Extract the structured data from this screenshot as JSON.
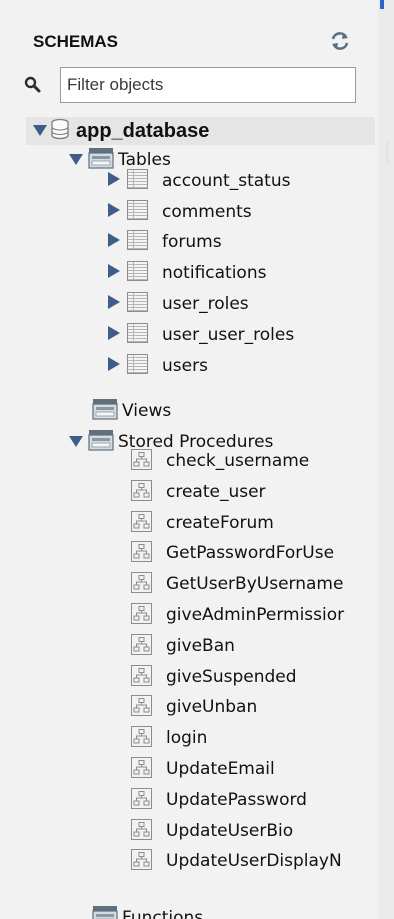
{
  "header": {
    "title": "SCHEMAS"
  },
  "search": {
    "placeholder": "Filter objects",
    "value": ""
  },
  "schema": {
    "name": "app_database",
    "groups": {
      "tables": {
        "label": "Tables",
        "items": [
          "account_status",
          "comments",
          "forums",
          "notifications",
          "user_roles",
          "user_user_roles",
          "users"
        ]
      },
      "views": {
        "label": "Views"
      },
      "procedures": {
        "label": "Stored Procedures",
        "items": [
          "check_username",
          "create_user",
          "createForum",
          "GetPasswordForUse",
          "GetUserByUsername",
          "giveAdminPermissior",
          "giveBan",
          "giveSuspended",
          "giveUnban",
          "login",
          "UpdateEmail",
          "UpdatePassword",
          "UpdateUserBio",
          "UpdateUserDisplayN"
        ]
      },
      "functions": {
        "label": "Functions"
      }
    }
  },
  "colors": {
    "accent": "#2b63c9",
    "selected_row": "#e5e5e5",
    "background": "#f2f2f2"
  },
  "icons": {
    "refresh": "refresh-icon",
    "search": "search-icon",
    "database": "database-icon",
    "folder": "folder-icon",
    "table": "table-icon",
    "procedure": "procedure-icon"
  }
}
